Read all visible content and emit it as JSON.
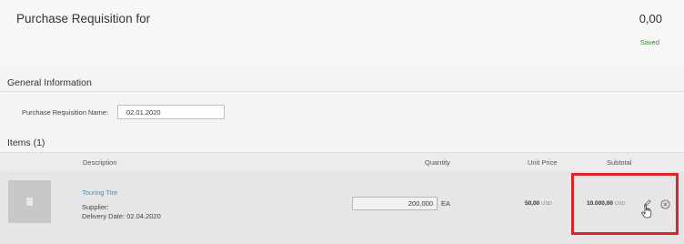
{
  "header": {
    "title": "Purchase Requisition for",
    "total": "0,00",
    "status": "Saved",
    "status_color": "#2e8b3a"
  },
  "general": {
    "section_title": "General Information",
    "pr_name_label": "Purchase Requisition Name:",
    "pr_name_value": "02.01.2020"
  },
  "items": {
    "section_title": "Items (1)",
    "columns": {
      "description": "Description",
      "quantity": "Quantity",
      "unit_price": "Unit Price",
      "subtotal": "Subtotal"
    },
    "rows": [
      {
        "thumbnail_icon": "product-placeholder-icon",
        "name": "Touring Tire",
        "supplier_label": "Supplier:",
        "delivery_label": "Delivery Date:",
        "delivery_date": "02.04.2020",
        "quantity": "200,000",
        "unit": "EA",
        "unit_price": "50,00",
        "unit_price_currency": "USD",
        "subtotal": "10.000,00",
        "subtotal_currency": "USD",
        "edit_icon": "pencil-icon",
        "remove_icon": "close-circle-icon"
      }
    ]
  },
  "highlight_color": "#e0222a",
  "link_color": "#3f8fb9"
}
